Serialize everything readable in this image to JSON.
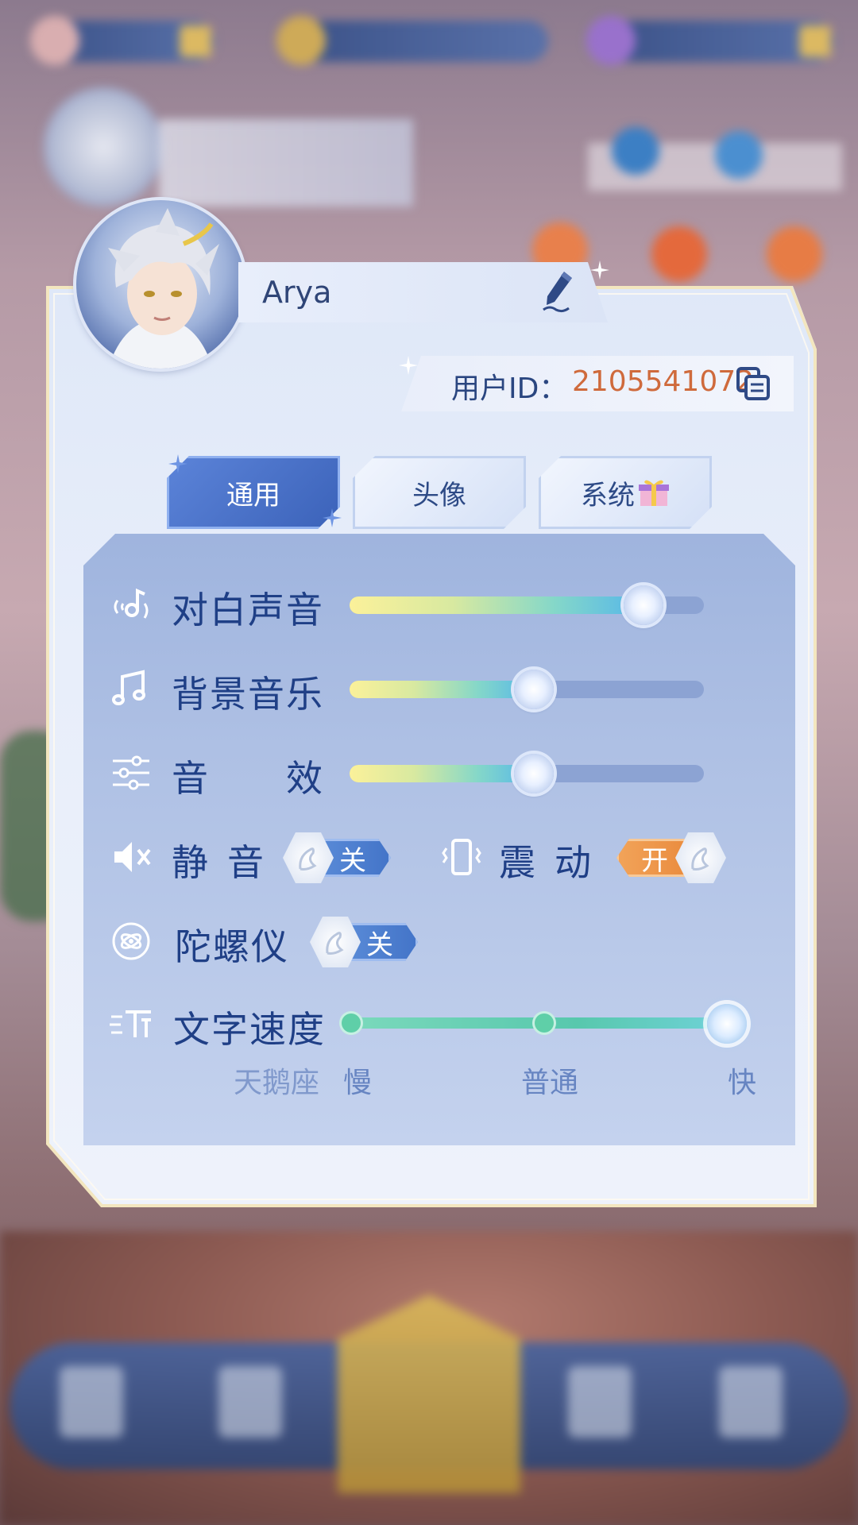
{
  "profile": {
    "name": "Arya",
    "uid_label": "用户ID：",
    "uid_value": "2105541072"
  },
  "tabs": [
    {
      "label": "通用",
      "active": true
    },
    {
      "label": "头像",
      "active": false
    },
    {
      "label": "系统",
      "active": false
    }
  ],
  "settings": {
    "dialogue_voice": {
      "label": "对白声音",
      "level": 0.83
    },
    "bgm": {
      "label": "背景音乐",
      "level": 0.52
    },
    "sfx": {
      "label_1": "音",
      "label_2": "效",
      "level": 0.52
    },
    "mute": {
      "label_1": "静",
      "label_2": "音",
      "state": "关"
    },
    "vibration": {
      "label_1": "震",
      "label_2": "动",
      "state": "开"
    },
    "gyroscope": {
      "label": "陀螺仪",
      "state": "关"
    },
    "text_speed": {
      "label": "文字速度",
      "hint": "天鹅座",
      "options": [
        "慢",
        "普通",
        "快"
      ],
      "selected": "快"
    }
  },
  "colors": {
    "accent": "#3b62b9",
    "uid_value": "#cf6a3c",
    "label_text": "#1f3f86",
    "toggle_on": "#e98a3c",
    "toggle_off": "#4374c8"
  },
  "icons": [
    "pencil-icon",
    "copy-icon",
    "gift-icon",
    "voice-icon",
    "music-note-icon",
    "equalizer-icon",
    "speaker-mute-icon",
    "vibrate-phone-icon",
    "gyroscope-icon",
    "text-speed-icon",
    "swan-icon"
  ]
}
